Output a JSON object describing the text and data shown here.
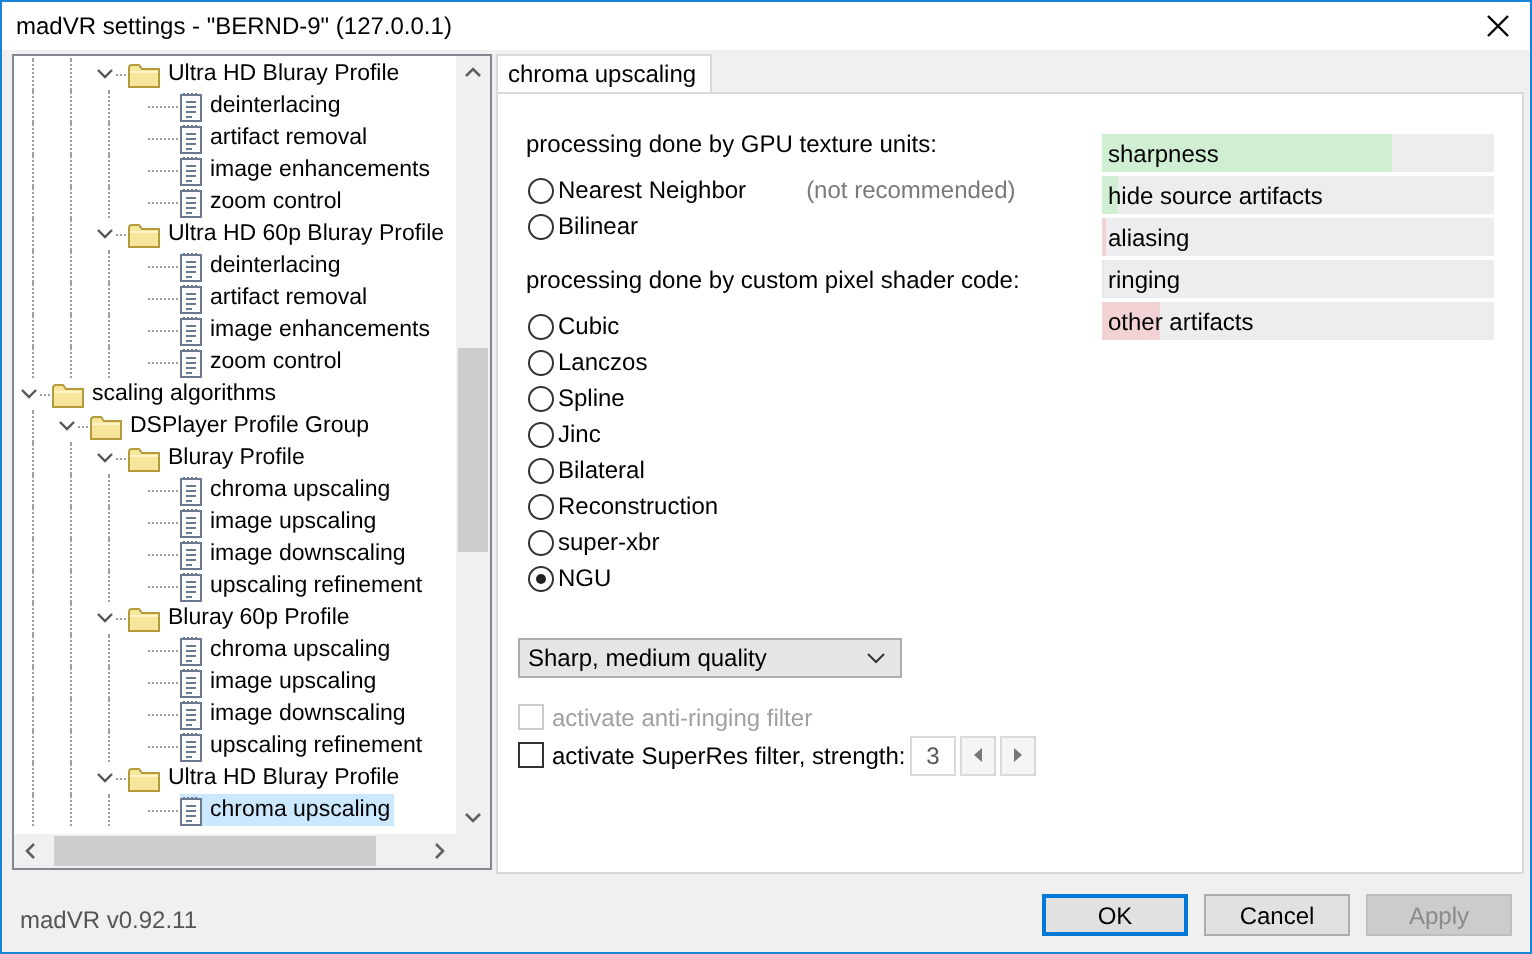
{
  "window": {
    "title": "madVR settings - \"BERND-9\" (127.0.0.1)"
  },
  "tree": {
    "items": [
      {
        "children": [
          {
            "children": [
              {
                "kind": "folder",
                "label": "Ultra HD Bluray Profile",
                "expanded": true,
                "selected": false,
                "children": [
                  {
                    "kind": "page",
                    "label": "deinterlacing",
                    "selected": false
                  },
                  {
                    "kind": "page",
                    "label": "artifact removal",
                    "selected": false
                  },
                  {
                    "kind": "page",
                    "label": "image enhancements",
                    "selected": false
                  },
                  {
                    "kind": "page",
                    "label": "zoom control",
                    "selected": false
                  }
                ]
              },
              {
                "kind": "folder",
                "label": "Ultra HD 60p Bluray Profile",
                "expanded": true,
                "selected": false,
                "children": [
                  {
                    "kind": "page",
                    "label": "deinterlacing",
                    "selected": false
                  },
                  {
                    "kind": "page",
                    "label": "artifact removal",
                    "selected": false
                  },
                  {
                    "kind": "page",
                    "label": "image enhancements",
                    "selected": false
                  },
                  {
                    "kind": "page",
                    "label": "zoom control",
                    "selected": false
                  }
                ]
              }
            ]
          }
        ]
      },
      {
        "kind": "folder",
        "label": "scaling algorithms",
        "expanded": true,
        "selected": false,
        "children": [
          {
            "kind": "folder",
            "label": "DSPlayer Profile Group",
            "expanded": true,
            "selected": false,
            "children": [
              {
                "kind": "folder",
                "label": "Bluray Profile",
                "expanded": true,
                "selected": false,
                "children": [
                  {
                    "kind": "page",
                    "label": "chroma upscaling",
                    "selected": false
                  },
                  {
                    "kind": "page",
                    "label": "image upscaling",
                    "selected": false
                  },
                  {
                    "kind": "page",
                    "label": "image downscaling",
                    "selected": false
                  },
                  {
                    "kind": "page",
                    "label": "upscaling refinement",
                    "selected": false
                  }
                ]
              },
              {
                "kind": "folder",
                "label": "Bluray 60p Profile",
                "expanded": true,
                "selected": false,
                "children": [
                  {
                    "kind": "page",
                    "label": "chroma upscaling",
                    "selected": false
                  },
                  {
                    "kind": "page",
                    "label": "image upscaling",
                    "selected": false
                  },
                  {
                    "kind": "page",
                    "label": "image downscaling",
                    "selected": false
                  },
                  {
                    "kind": "page",
                    "label": "upscaling refinement",
                    "selected": false
                  }
                ]
              },
              {
                "kind": "folder",
                "label": "Ultra HD Bluray Profile",
                "expanded": true,
                "selected": false,
                "children": [
                  {
                    "kind": "page",
                    "label": "chroma upscaling",
                    "selected": true
                  }
                ]
              }
            ]
          }
        ]
      }
    ]
  },
  "tabs": [
    {
      "label": "chroma upscaling",
      "selected": true
    }
  ],
  "groups": [
    {
      "heading": "processing done by GPU texture units:",
      "options": [
        {
          "label": "Nearest Neighbor",
          "note": "(not recommended)",
          "selected": false
        },
        {
          "label": "Bilinear",
          "selected": false
        }
      ]
    },
    {
      "heading": "processing done by custom pixel shader code:",
      "options": [
        {
          "label": "Cubic",
          "selected": false
        },
        {
          "label": "Lanczos",
          "selected": false
        },
        {
          "label": "Spline",
          "selected": false
        },
        {
          "label": "Jinc",
          "selected": false
        },
        {
          "label": "Bilateral",
          "selected": false
        },
        {
          "label": "Reconstruction",
          "selected": false
        },
        {
          "label": "super-xbr",
          "selected": false
        },
        {
          "label": "NGU",
          "selected": true
        }
      ]
    }
  ],
  "dropdown": {
    "value": "Sharp, medium quality"
  },
  "checks": [
    {
      "label": "activate anti-ringing filter",
      "checked": false,
      "disabled": true
    },
    {
      "label": "activate SuperRes filter, strength:",
      "checked": false,
      "disabled": false,
      "spin": {
        "value": "3"
      }
    }
  ],
  "meters": [
    {
      "label": "sharpness",
      "level": 0.74,
      "color": "#d0efd2"
    },
    {
      "label": "hide source artifacts",
      "level": 0.04,
      "color": "#d0efd2"
    },
    {
      "label": "aliasing",
      "level": 0.01,
      "color": "#f2d2d4"
    },
    {
      "label": "ringing",
      "level": 0
    },
    {
      "label": "other artifacts",
      "level": 0.15,
      "color": "#f2d2d4"
    }
  ],
  "footer": {
    "version": "madVR v0.92.11",
    "buttons": [
      {
        "label": "OK",
        "default": true,
        "disabled": false
      },
      {
        "label": "Cancel",
        "default": false,
        "disabled": false
      },
      {
        "label": "Apply",
        "default": false,
        "disabled": true
      }
    ]
  }
}
